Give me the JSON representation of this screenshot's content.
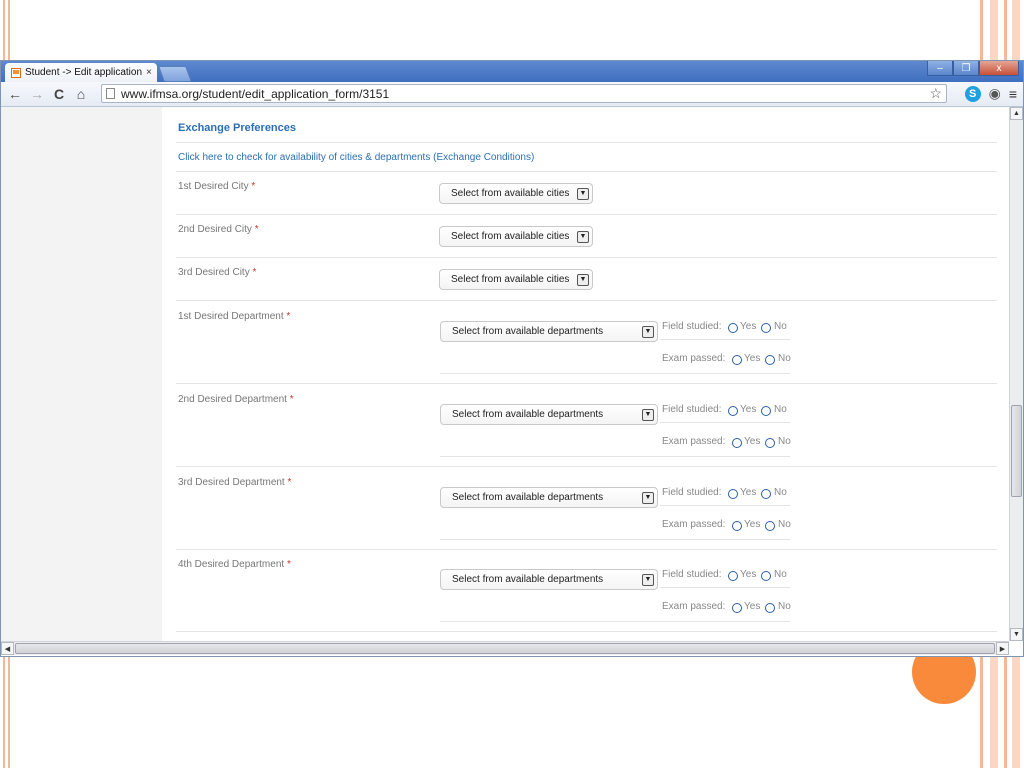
{
  "tab": {
    "title": "Student -> Edit application fo",
    "close": "×"
  },
  "window_controls": {
    "minimize": "–",
    "restore": "❐",
    "close": "x"
  },
  "toolbar": {
    "back": "←",
    "forward": "→",
    "reload": "C",
    "home": "⌂",
    "url": "www.ifmsa.org/student/edit_application_form/3151",
    "star": "☆",
    "skype": "S",
    "eye": "◉",
    "menu": "≡"
  },
  "form": {
    "section_title": "Exchange Preferences",
    "availability_link": "Click here to check for availability of cities & departments (Exchange Conditions)",
    "required_marker": "*",
    "cities": [
      {
        "label": "1st Desired City",
        "select": "Select from available cities"
      },
      {
        "label": "2nd Desired City",
        "select": "Select from available cities"
      },
      {
        "label": "3rd Desired City",
        "select": "Select from available cities"
      }
    ],
    "departments": [
      {
        "label": "1st Desired Department",
        "select": "Select from available departments"
      },
      {
        "label": "2nd Desired Department",
        "select": "Select from available departments"
      },
      {
        "label": "3rd Desired Department",
        "select": "Select from available departments"
      },
      {
        "label": "4th Desired Department",
        "select": "Select from available departments"
      }
    ],
    "field_studied_label": "Field studied:",
    "exam_passed_label": "Exam passed:",
    "yes": "Yes",
    "no": "No"
  },
  "colors": {
    "accent_link": "#2b6fb3",
    "deco_orange": "#fa8a3b",
    "required": "#c0392b"
  }
}
